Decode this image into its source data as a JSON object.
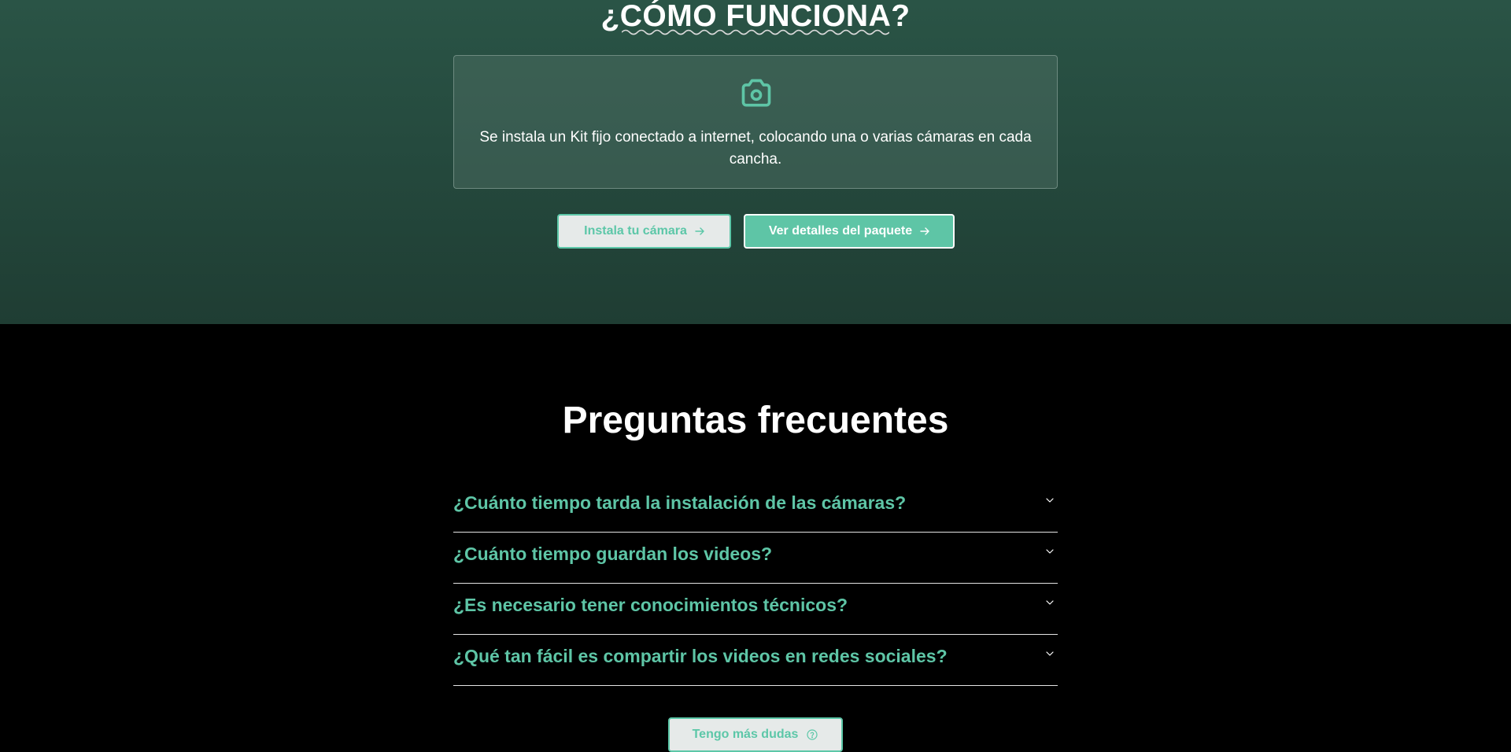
{
  "how_it_works": {
    "title": "¿CÓMO FUNCIONA?",
    "card_text": "Se instala un Kit fijo conectado a internet, colocando una o varias cámaras en cada cancha.",
    "card_icon": "camera-icon",
    "install_button": "Instala tu cámara",
    "details_button": "Ver detalles del paquete"
  },
  "faq": {
    "title": "Preguntas frecuentes",
    "items": [
      {
        "question": "¿Cuánto tiempo tarda la instalación de las cámaras?"
      },
      {
        "question": "¿Cuánto tiempo guardan los videos?"
      },
      {
        "question": "¿Es necesario tener conocimientos técnicos?"
      },
      {
        "question": "¿Qué tan fácil es compartir los videos en redes sociales?"
      }
    ],
    "more_button": "Tengo más dudas"
  },
  "colors": {
    "accent": "#5ec5a6",
    "section_bg_top": "#2a5446",
    "section_bg_bottom": "#1f3d33",
    "page_bg": "#000000"
  }
}
